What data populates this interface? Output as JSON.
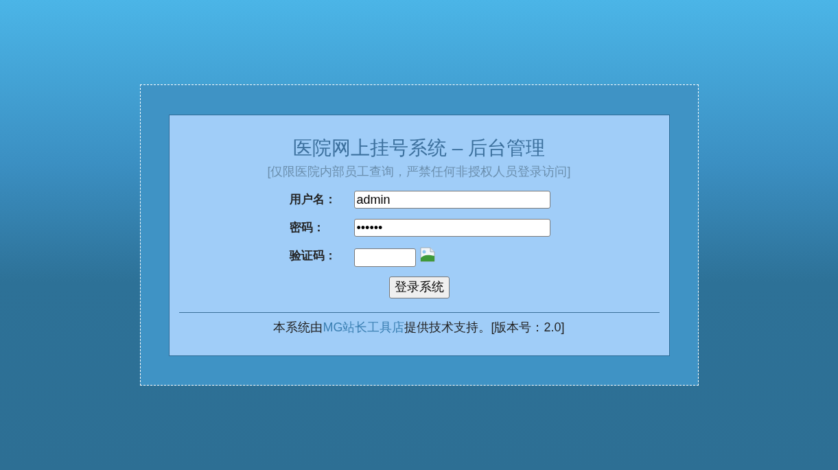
{
  "title": "医院网上挂号系统 – 后台管理",
  "notice": "[仅限医院内部员工查询，严禁任何非授权人员登录访问]",
  "fields": [
    {
      "kind": "text",
      "label": "用户名：",
      "value": "admin"
    },
    {
      "kind": "password",
      "label": "密码：",
      "value": "••••••"
    },
    {
      "kind": "captcha",
      "label": "验证码："
    }
  ],
  "submit": "登录系统",
  "footer": {
    "prefix": "本系统由",
    "link": "MG站长工具店",
    "suffix": "提供技术支持。[版本号：2.0]"
  }
}
